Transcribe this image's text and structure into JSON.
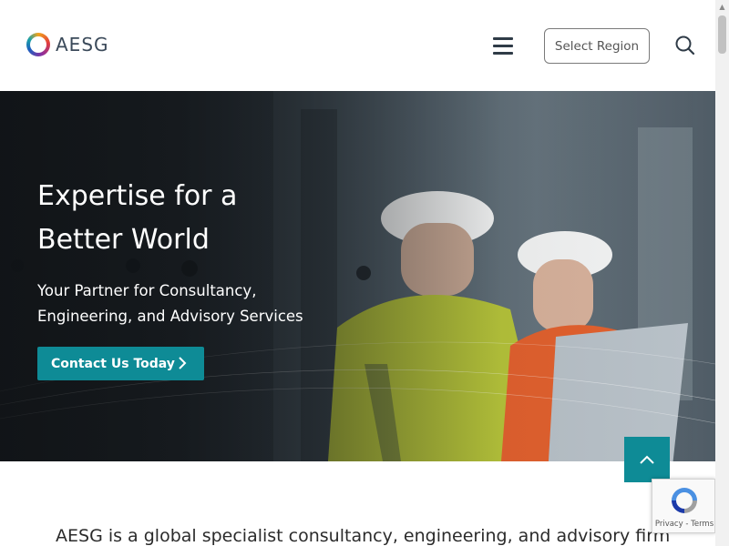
{
  "header": {
    "logo_text": "AESG",
    "region_label": "Select Region"
  },
  "hero": {
    "title": "Expertise for a Better World",
    "subtitle": "Your Partner for Consultancy, Engineering, and Advisory Services",
    "cta_label": "Contact Us Today"
  },
  "intro": {
    "text": "AESG is a global specialist consultancy, engineering, and advisory firm"
  },
  "recaptcha": {
    "links": "Privacy - Terms"
  },
  "colors": {
    "accent": "#0e8b96",
    "header_bg": "#ffffff",
    "text": "#2b2b2b"
  },
  "icons": [
    "menu-icon",
    "search-icon",
    "chevron-right-icon",
    "chevron-up-icon",
    "recaptcha-icon"
  ]
}
